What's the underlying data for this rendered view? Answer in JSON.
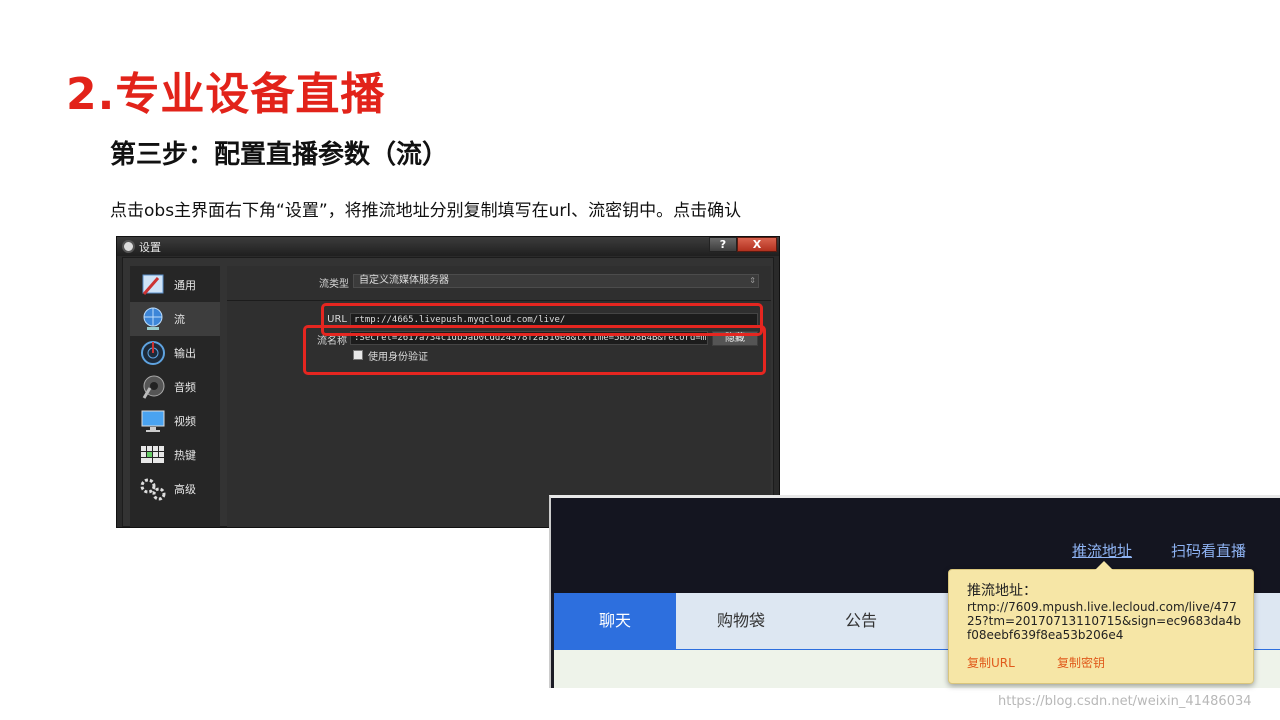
{
  "slide": {
    "title": "2.专业设备直播",
    "step_title": "第三步：配置直播参数（流）",
    "instruction": "点击obs主界面右下角“设置”，将推流地址分别复制填写在url、流密钥中。点击确认"
  },
  "obs": {
    "window_title": "设置",
    "help_label": "?",
    "close_label": "X",
    "sidebar": [
      {
        "label": "通用",
        "icon": "general-icon"
      },
      {
        "label": "流",
        "icon": "stream-globe-icon"
      },
      {
        "label": "输出",
        "icon": "output-icon"
      },
      {
        "label": "音频",
        "icon": "audio-icon"
      },
      {
        "label": "视频",
        "icon": "video-monitor-icon"
      },
      {
        "label": "热键",
        "icon": "keyboard-icon"
      },
      {
        "label": "高级",
        "icon": "gears-icon"
      }
    ],
    "stream_type_label": "流类型",
    "stream_type_value": "自定义流媒体服务器",
    "url_label": "URL",
    "url_value": "rtmp://4665.livepush.myqcloud.com/live/",
    "key_label": "流名称",
    "key_value": ":Secret=2617a734c1db5ab0cdd24578f2a310e8&txTime=5BD58B4B&record=mp4",
    "hide_button": "隐藏",
    "auth_checkbox_label": "使用身份验证",
    "highlight_color": "#e52620"
  },
  "web": {
    "nav_links": [
      "推流地址",
      "扫码看直播"
    ],
    "tabs": [
      "聊天",
      "购物袋",
      "公告"
    ],
    "active_tab": "聊天",
    "accent_color": "#2d6fde"
  },
  "popup": {
    "title": "推流地址：",
    "url": "rtmp://7609.mpush.live.lecloud.com/live/47725?tm=20170713110715&sign=ec9683da4bf08eebf639f8ea53b206e4",
    "copy_url": "复制URL",
    "copy_key": "复制密钥"
  },
  "watermark": "https://blog.csdn.net/weixin_41486034"
}
